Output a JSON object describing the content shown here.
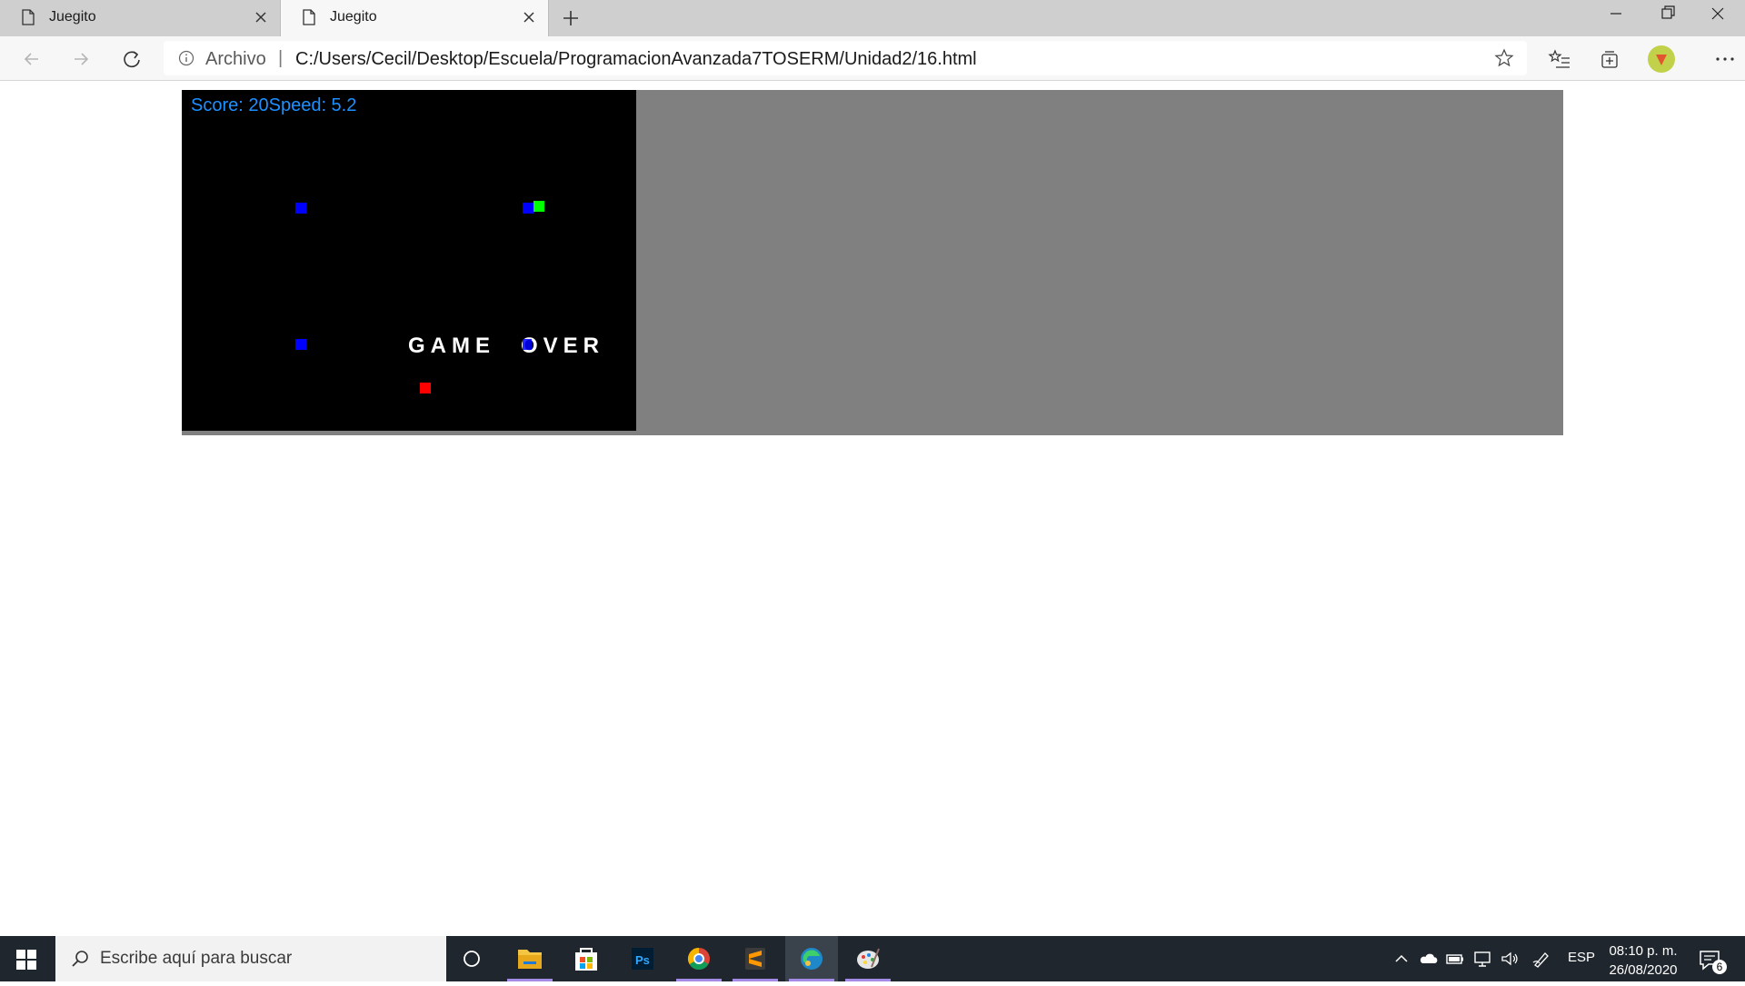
{
  "browser": {
    "tabs": [
      {
        "title": "Juegito",
        "active": false
      },
      {
        "title": "Juegito",
        "active": true
      }
    ],
    "address": {
      "scheme_label": "Archivo",
      "separator": "|",
      "url": "C:/Users/Cecil/Desktop/Escuela/ProgramacionAvanzada7TOSERM/Unidad2/16.html"
    }
  },
  "game": {
    "hud": "Score: 20Speed: 5.2",
    "game_over_left": "GAME",
    "game_over_right": "OVER",
    "colors": {
      "background": "#000000",
      "hud_text": "#1e90ff",
      "snake_segment": "#0000ff",
      "head": "#00ff00",
      "food": "#ff0000",
      "page_bg": "#808080"
    }
  },
  "taskbar": {
    "search_placeholder": "Escribe aquí para buscar",
    "apps": [
      "task-view",
      "file-explorer",
      "microsoft-store",
      "photoshop",
      "chrome",
      "sublime-text",
      "edge",
      "paint"
    ],
    "language": "ESP",
    "time": "08:10 p. m.",
    "date": "26/08/2020",
    "notification_count": "6"
  }
}
